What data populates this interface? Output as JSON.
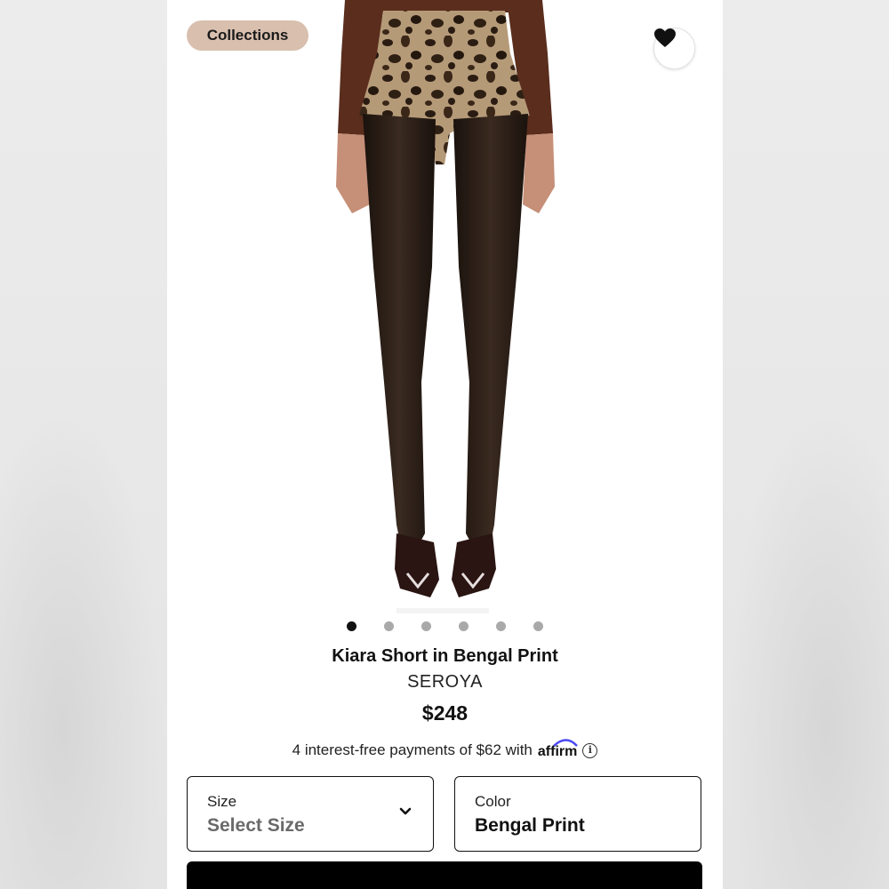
{
  "header": {
    "collections_label": "Collections"
  },
  "product": {
    "title": "Kiara Short in Bengal Print",
    "brand": "SEROYA",
    "price": "$248",
    "installments_text": "4 interest-free payments of $62 with",
    "affirm_label": "affirm"
  },
  "gallery": {
    "image_count": 6,
    "active_index": 0
  },
  "options": {
    "size": {
      "label": "Size",
      "value": "Select Size"
    },
    "color": {
      "label": "Color",
      "value": "Bengal Print"
    }
  },
  "icons": [
    "heart-icon",
    "info-icon",
    "chevron-down-icon"
  ],
  "colors": {
    "accent_pill": "#d8bfae",
    "primary": "#000000",
    "active_dot": "#111111",
    "inactive_dot": "#a9a9a9"
  }
}
